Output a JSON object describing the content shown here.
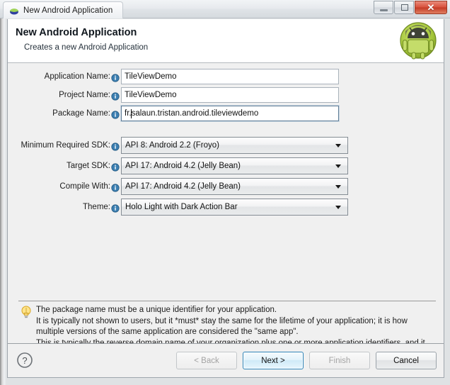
{
  "window": {
    "title": "New Android Application",
    "icon": "android-icon",
    "buttons": {
      "minimize": "minimize-icon",
      "restore": "restore-icon",
      "close": "✕"
    }
  },
  "header": {
    "title": "New Android Application",
    "subtitle": "Creates a new Android Application",
    "logo": "android-robot-logo"
  },
  "form": {
    "text_fields": [
      {
        "label": "Application Name:",
        "value": "TileViewDemo",
        "focused": false,
        "caret_after": null
      },
      {
        "label": "Project Name:",
        "value": "TileViewDemo",
        "focused": false,
        "caret_after": null
      },
      {
        "label": "Package Name:",
        "value": "fr.salaun.tristan.android.tileviewdemo",
        "focused": true,
        "caret_after": 3
      }
    ],
    "combos": [
      {
        "label": "Minimum Required SDK:",
        "value": "API 8: Android 2.2 (Froyo)"
      },
      {
        "label": "Target SDK:",
        "value": "API 17: Android 4.2 (Jelly Bean)"
      },
      {
        "label": "Compile With:",
        "value": "API 17: Android 4.2 (Jelly Bean)"
      },
      {
        "label": "Theme:",
        "value": "Holo Light with Dark Action Bar"
      }
    ]
  },
  "hint": {
    "icon": "lightbulb-icon",
    "lines": [
      "The package name must be a unique identifier for your application.",
      "It is typically not shown to users, but it *must* stay the same for the lifetime of your application; it is how",
      "multiple versions of the same application are considered the \"same app\".",
      "This is typically the reverse domain name of your organization plus one or more application identifiers, and it"
    ]
  },
  "footer": {
    "help": "?",
    "buttons": [
      {
        "name": "back-button",
        "label": "< Back",
        "enabled": false,
        "default": false
      },
      {
        "name": "next-button",
        "label": "Next >",
        "enabled": true,
        "default": true
      },
      {
        "name": "finish-button",
        "label": "Finish",
        "enabled": false,
        "default": false
      },
      {
        "name": "cancel-button",
        "label": "Cancel",
        "enabled": true,
        "default": false
      }
    ]
  },
  "colors": {
    "accent": "#2e84b8",
    "android_green": "#a4c639",
    "dialog_bg": "#f0f0f0",
    "close_red": "#c43a25"
  }
}
